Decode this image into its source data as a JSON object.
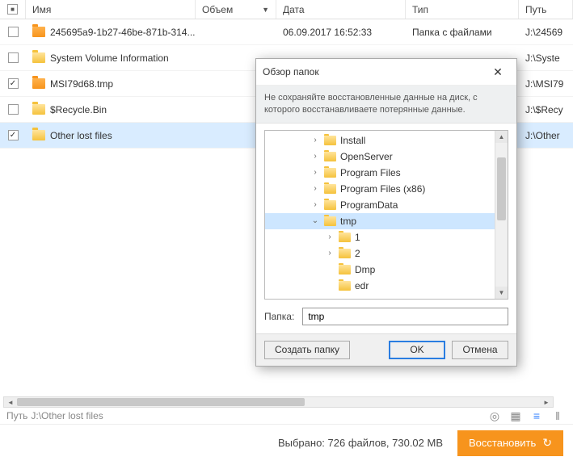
{
  "headers": {
    "name": "Имя",
    "volume": "Объем",
    "date": "Дата",
    "type": "Тип",
    "path": "Путь"
  },
  "rows": [
    {
      "checked": "none",
      "icon": "orange",
      "name": "245695a9-1b27-46be-871b-314...",
      "volume": "",
      "date": "06.09.2017 16:52:33",
      "type": "Папка с файлами",
      "path": "J:\\24569"
    },
    {
      "checked": "none",
      "icon": "yellow",
      "name": "System Volume Information",
      "volume": "",
      "date": "",
      "type": "",
      "path": "J:\\Syste"
    },
    {
      "checked": "check",
      "icon": "orange",
      "name": "MSI79d68.tmp",
      "volume": "",
      "date": "",
      "type": "",
      "path": "J:\\MSI79"
    },
    {
      "checked": "none",
      "icon": "yellow",
      "name": "$Recycle.Bin",
      "volume": "",
      "date": "",
      "type": "",
      "path": "J:\\$Recy"
    },
    {
      "checked": "check",
      "icon": "yellow",
      "name": "Other lost files",
      "volume": "",
      "date": "",
      "type": "",
      "path": "J:\\Other",
      "selected": true
    }
  ],
  "dialog": {
    "title": "Обзор папок",
    "info": "Не сохраняйте восстановленные данные на диск, с которого восстанавливаете потерянные данные.",
    "tree": [
      {
        "depth": 2,
        "exp": ">",
        "label": "Install"
      },
      {
        "depth": 2,
        "exp": ">",
        "label": "OpenServer"
      },
      {
        "depth": 2,
        "exp": ">",
        "label": "Program Files"
      },
      {
        "depth": 2,
        "exp": ">",
        "label": "Program Files (x86)"
      },
      {
        "depth": 2,
        "exp": ">",
        "label": "ProgramData"
      },
      {
        "depth": 2,
        "exp": "v",
        "label": "tmp",
        "selected": true
      },
      {
        "depth": 3,
        "exp": ">",
        "label": "1"
      },
      {
        "depth": 3,
        "exp": ">",
        "label": "2"
      },
      {
        "depth": 3,
        "exp": "",
        "label": "Dmp"
      },
      {
        "depth": 3,
        "exp": "",
        "label": "edr"
      }
    ],
    "fieldLabel": "Папка:",
    "fieldValue": "tmp",
    "createBtn": "Создать папку",
    "okBtn": "OK",
    "cancelBtn": "Отмена"
  },
  "status": {
    "pathLabel": "Путь",
    "pathValue": "J:\\Other lost files"
  },
  "footer": {
    "selectedLabel": "Выбрано:",
    "selectedValue": "726 файлов, 730.02 MB",
    "restore": "Восстановить"
  }
}
